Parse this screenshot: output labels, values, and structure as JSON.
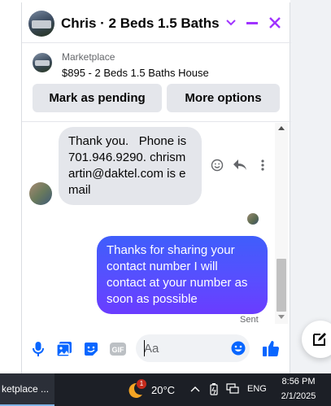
{
  "chat": {
    "title": "Chris · 2 Beds 1.5 Baths Ho...",
    "listing": {
      "source": "Marketplace",
      "title": "$895 - 2 Beds 1.5 Baths House"
    },
    "actions": {
      "mark_pending": "Mark as pending",
      "more_options": "More options"
    },
    "messages": [
      {
        "direction": "incoming",
        "text": "Thank you.   Phone is 701.946.9290. chrismartin@daktel.com is email"
      },
      {
        "direction": "outgoing",
        "text": "Thanks for sharing your contact number I will contact at your number as soon as possible"
      }
    ],
    "sent_status": "Sent",
    "composer": {
      "placeholder": "Aa"
    },
    "accent_color": "#a033ff",
    "outgoing_gradient": [
      "#3f5efb",
      "#6a3cff"
    ],
    "icon_color": "#0866ff"
  },
  "taskbar": {
    "app_label": "ketplace ...",
    "weather_badge": "1",
    "temperature": "20°C",
    "language": "ENG",
    "time": "8:56 PM",
    "date": "2/1/2025"
  }
}
